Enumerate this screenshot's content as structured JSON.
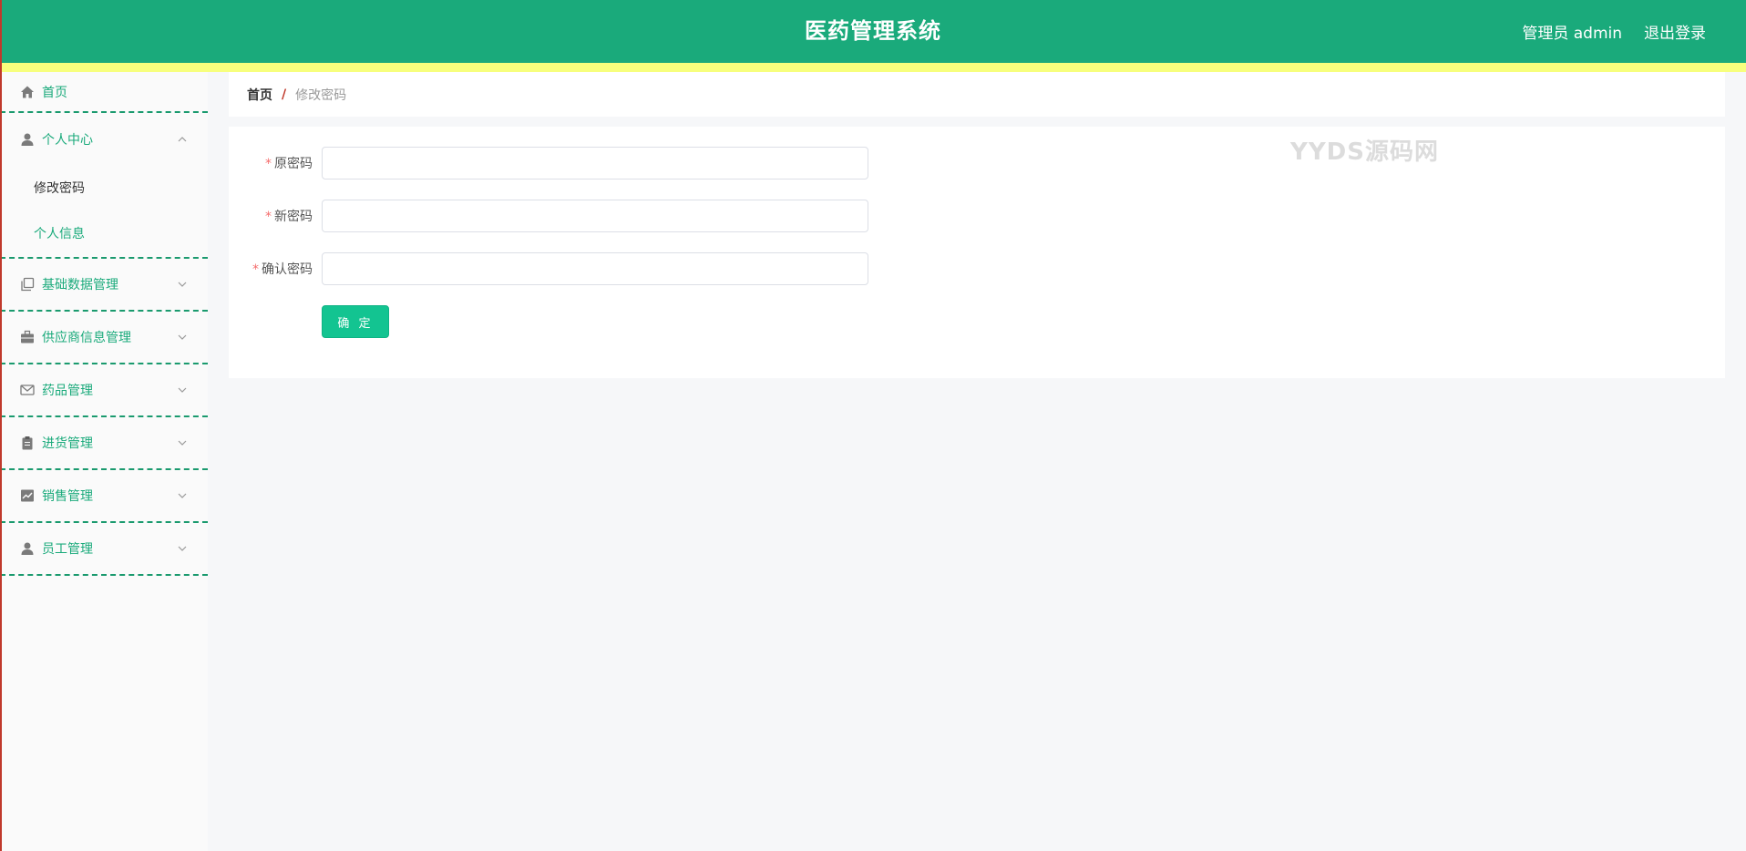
{
  "header": {
    "title": "医药管理系统",
    "user": "管理员 admin",
    "logout": "退出登录",
    "bg_color": "#1aaa7b",
    "strip_color": "#f7ff7d"
  },
  "sidebar": {
    "items": [
      {
        "label": "首页",
        "icon": "home-icon"
      },
      {
        "label": "个人中心",
        "icon": "user-icon",
        "expanded": true,
        "children": [
          {
            "label": "修改密码",
            "active": true
          },
          {
            "label": "个人信息",
            "active": false
          }
        ]
      },
      {
        "label": "基础数据管理",
        "icon": "copy-icon"
      },
      {
        "label": "供应商信息管理",
        "icon": "briefcase-icon"
      },
      {
        "label": "药品管理",
        "icon": "mail-icon"
      },
      {
        "label": "进货管理",
        "icon": "clipboard-icon"
      },
      {
        "label": "销售管理",
        "icon": "chart-icon"
      },
      {
        "label": "员工管理",
        "icon": "person-icon"
      }
    ]
  },
  "breadcrumb": {
    "home": "首页",
    "separator": "/",
    "current": "修改密码"
  },
  "form": {
    "fields": [
      {
        "label": "原密码",
        "required_mark": "*",
        "value": ""
      },
      {
        "label": "新密码",
        "required_mark": "*",
        "value": ""
      },
      {
        "label": "确认密码",
        "required_mark": "*",
        "value": ""
      }
    ],
    "submit_label": "确 定"
  },
  "watermark": "YYDS源码网",
  "accent_color": "#13c491"
}
